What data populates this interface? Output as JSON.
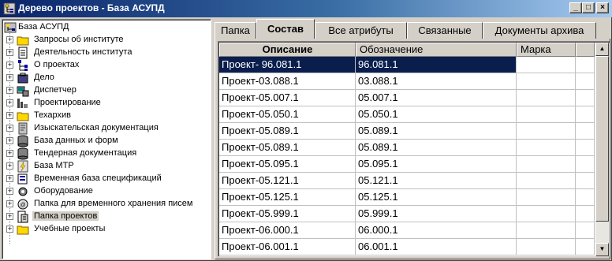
{
  "window": {
    "title": "Дерево проектов - База АСУПД",
    "min_glyph": "_",
    "max_glyph": "□",
    "close_glyph": "×"
  },
  "tree": {
    "root_label": "База АСУПД",
    "expander_glyph": "+",
    "items": [
      {
        "label": "Запросы об институте",
        "icon": "folder-icon"
      },
      {
        "label": "Деятельность института",
        "icon": "document-icon"
      },
      {
        "label": "О проектах",
        "icon": "tree-structure-icon"
      },
      {
        "label": "Дело",
        "icon": "case-icon"
      },
      {
        "label": "Диспетчер",
        "icon": "dispatcher-icon"
      },
      {
        "label": "Проектирование",
        "icon": "design-icon"
      },
      {
        "label": "Техархив",
        "icon": "folder-icon"
      },
      {
        "label": "Изыскательская документация",
        "icon": "survey-icon"
      },
      {
        "label": "База данных и форм",
        "icon": "database-icon"
      },
      {
        "label": "Тендерная документация",
        "icon": "database-icon"
      },
      {
        "label": "База МТР",
        "icon": "lightning-icon"
      },
      {
        "label": "Временная база спецификаций",
        "icon": "spec-icon"
      },
      {
        "label": "Оборудование",
        "icon": "equipment-icon"
      },
      {
        "label": "Папка для временного хранения писем",
        "icon": "letters-icon"
      },
      {
        "label": "Папка проектов",
        "icon": "projects-icon",
        "selected": true
      },
      {
        "label": "Учебные проекты",
        "icon": "folder-icon"
      }
    ]
  },
  "tabs": [
    {
      "label": "Папка"
    },
    {
      "label": "Состав",
      "active": true
    },
    {
      "label": "Все атрибуты"
    },
    {
      "label": "Связанные"
    },
    {
      "label": "Документы архива"
    }
  ],
  "grid": {
    "columns": [
      "Описание",
      "Обозначение",
      "Марка"
    ],
    "rows": [
      {
        "description": "Проект- 96.081.1",
        "designation": "96.081.1",
        "mark": "",
        "selected": true
      },
      {
        "description": "Проект-03.088.1",
        "designation": "03.088.1",
        "mark": ""
      },
      {
        "description": "Проект-05.007.1",
        "designation": "05.007.1",
        "mark": ""
      },
      {
        "description": "Проект-05.050.1",
        "designation": "05.050.1",
        "mark": ""
      },
      {
        "description": "Проект-05.089.1",
        "designation": "05.089.1",
        "mark": ""
      },
      {
        "description": "Проект-05.089.1",
        "designation": "05.089.1",
        "mark": ""
      },
      {
        "description": "Проект-05.095.1",
        "designation": "05.095.1",
        "mark": ""
      },
      {
        "description": "Проект-05.121.1",
        "designation": "05.121.1",
        "mark": ""
      },
      {
        "description": "Проект-05.125.1",
        "designation": "05.125.1",
        "mark": ""
      },
      {
        "description": "Проект-05.999.1",
        "designation": "05.999.1",
        "mark": ""
      },
      {
        "description": "Проект-06.000.1",
        "designation": "06.000.1",
        "mark": ""
      },
      {
        "description": "Проект-06.001.1",
        "designation": "06.001.1",
        "mark": ""
      }
    ]
  },
  "scrollbar": {
    "up_glyph": "▲",
    "down_glyph": "▼"
  },
  "colors": {
    "selection": "#0a1e4e",
    "titlebar": "#0a246a",
    "face": "#d4d0c8"
  }
}
